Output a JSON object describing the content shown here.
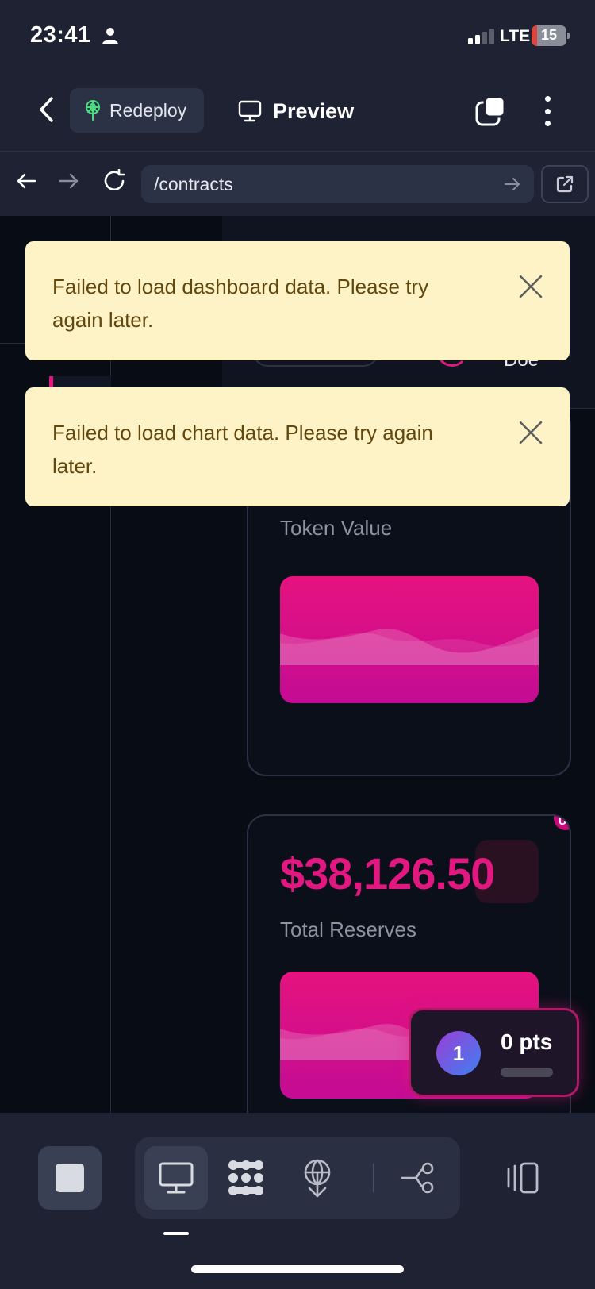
{
  "status_bar": {
    "time": "23:41",
    "network": "LTE",
    "battery": "15",
    "battery_level_percent": 15
  },
  "header": {
    "redeploy_label": "Redeploy",
    "preview_label": "Preview"
  },
  "browser": {
    "url": "/contracts"
  },
  "page": {
    "user_name_fragment": "Doe",
    "cards": [
      {
        "value": "",
        "label": "Token Value"
      },
      {
        "value": "$38,126.50",
        "label": "Total Reserves",
        "corner_badge": "US"
      }
    ]
  },
  "toasts": [
    {
      "message": "Failed to load dashboard data. Please try again later."
    },
    {
      "message": "Failed to load chart data. Please try again later."
    }
  ],
  "points_widget": {
    "level": "1",
    "points": "0 pts",
    "progress_fraction": 0
  },
  "toolbar": {
    "items": [
      "stop-icon",
      "desktop-icon",
      "nodes-icon",
      "deploy-icon",
      "git-branch-icon",
      "layout-icon"
    ]
  },
  "colors": {
    "accent": "#e0187f",
    "toast_bg": "#fef3c7",
    "toast_text": "#62480e",
    "app_bg": "#1e2233",
    "page_bg": "#080c15"
  }
}
